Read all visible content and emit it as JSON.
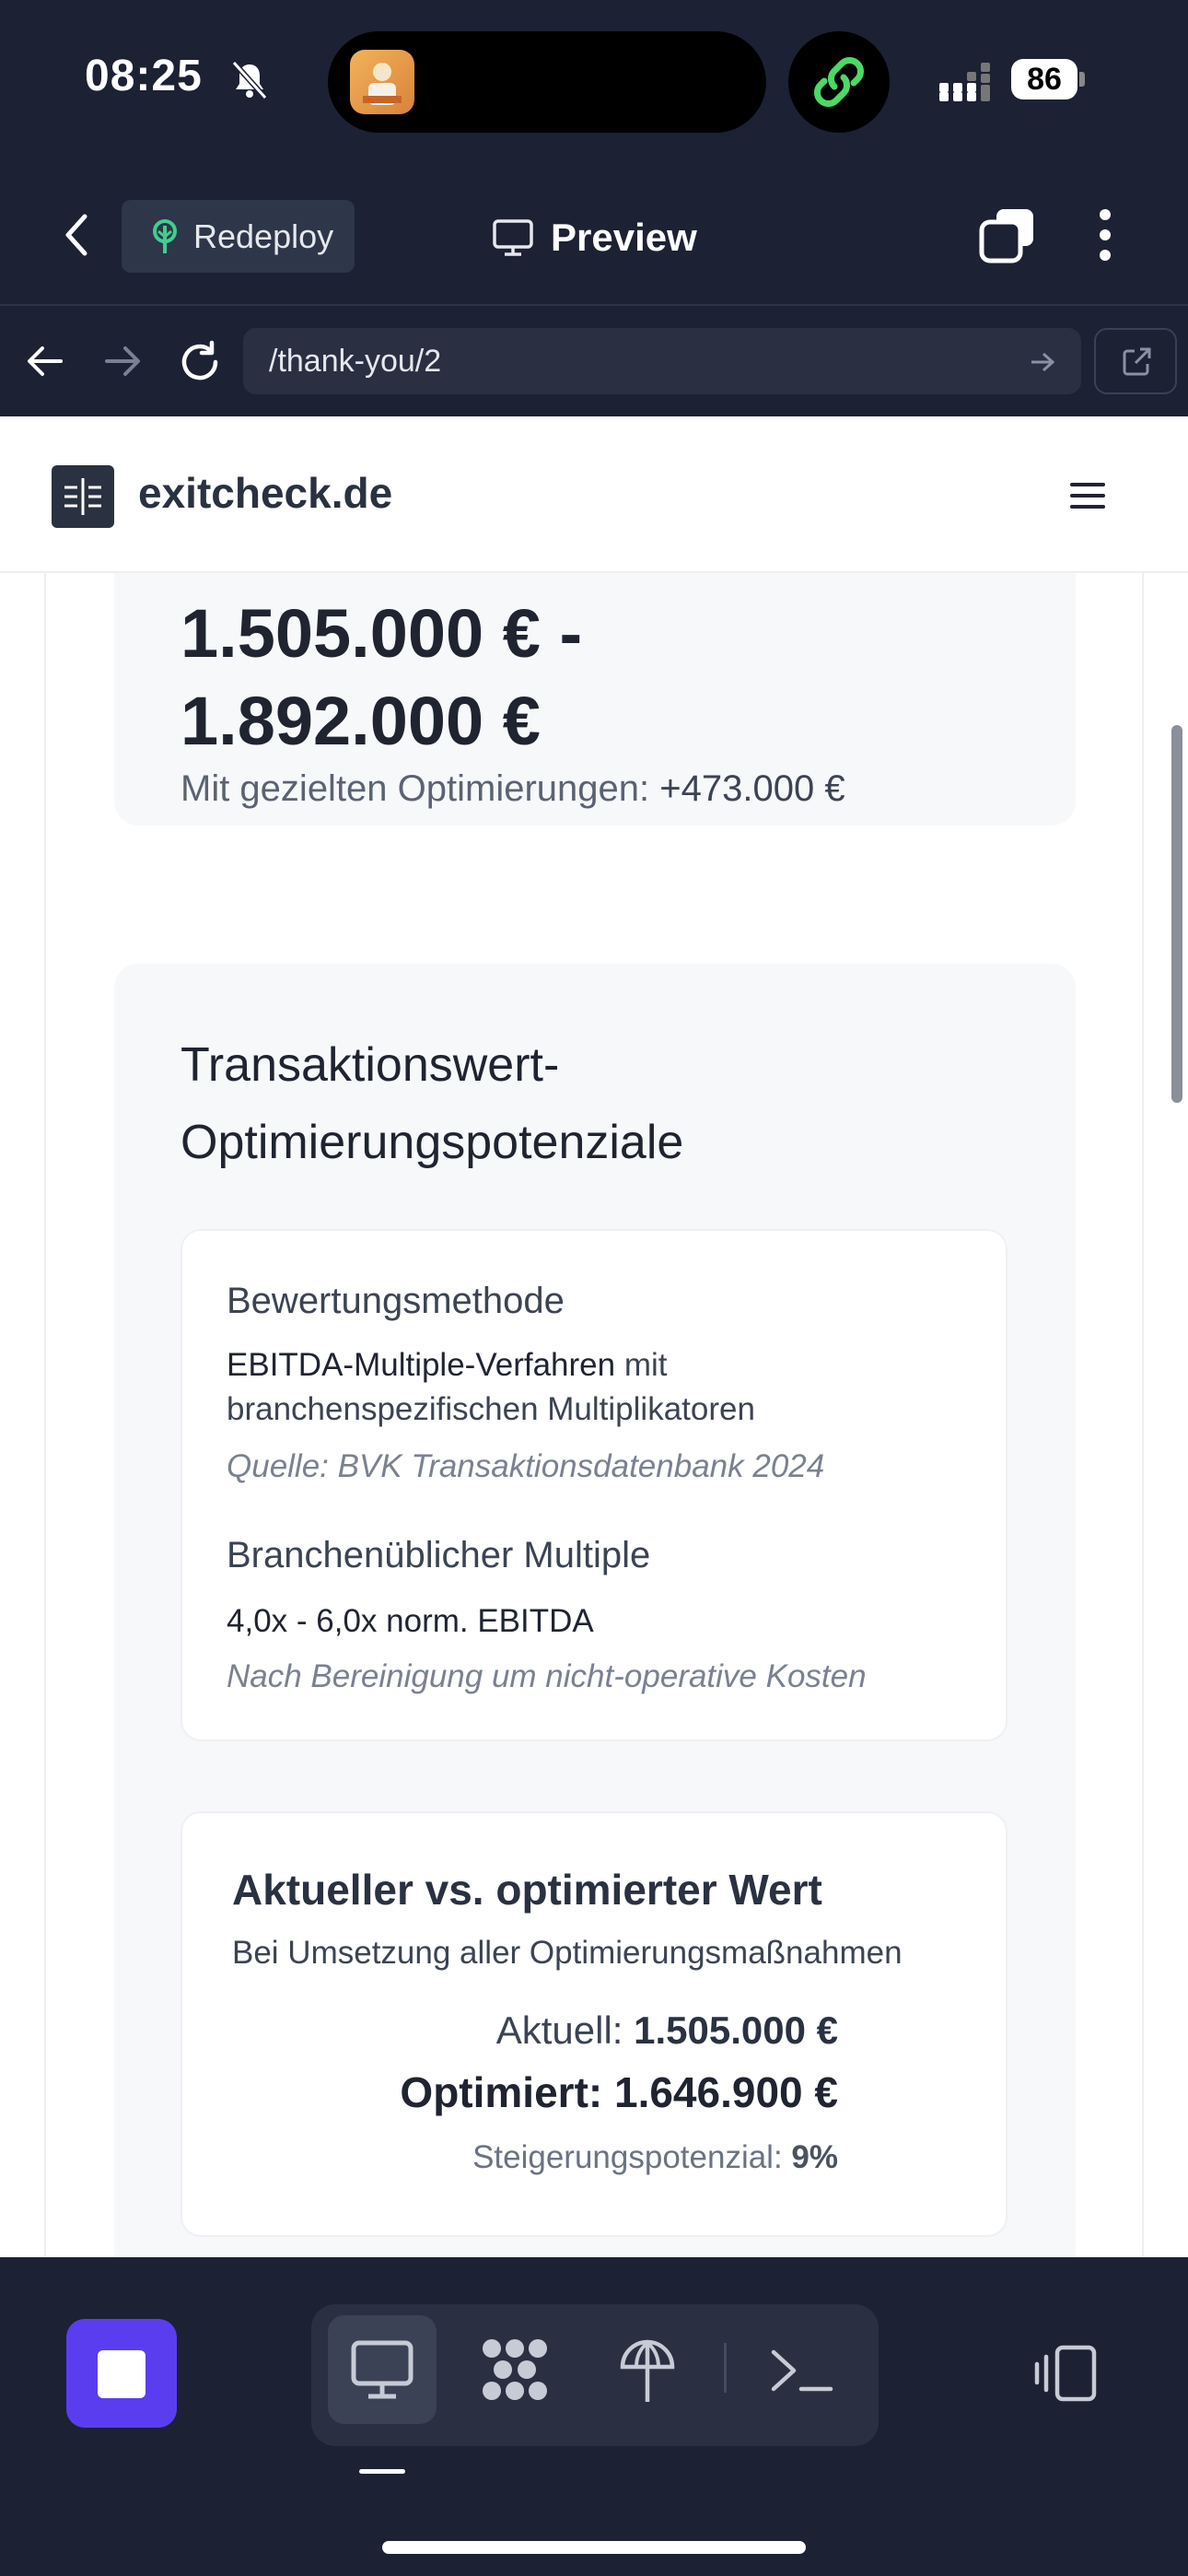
{
  "status_bar": {
    "time": "08:25",
    "battery": "86"
  },
  "app_bar": {
    "redeploy_label": "Redeploy",
    "preview_label": "Preview"
  },
  "browser": {
    "url": "/thank-you/2"
  },
  "site": {
    "name": "exitcheck.de"
  },
  "value_card": {
    "range_line1": "1.505.000 € -",
    "range_line2": "1.892.000 €",
    "optimization_prefix": "Mit gezielten Optimierungen: ",
    "optimization_value": "+473.000 €"
  },
  "potential_card": {
    "title_line1": "Transaktionswert-",
    "title_line2": "Optimierungspotenziale",
    "method": {
      "heading": "Bewertungsmethode",
      "strong": "EBITDA-Multiple-Verfahren",
      "rest_line1": " mit",
      "line2": "branchenspezifischen Multiplikatoren",
      "source": "Quelle: BVK Transaktionsdatenbank 2024"
    },
    "multiple": {
      "heading": "Branchenüblicher Multiple",
      "value": "4,0x - 6,0x norm. EBITDA",
      "note": "Nach Bereinigung um nicht-operative Kosten"
    }
  },
  "comparison_card": {
    "title": "Aktueller vs. optimierter Wert",
    "subtitle": "Bei Umsetzung aller Optimierungsmaßnahmen",
    "current_label": "Aktuell: ",
    "current_value": "1.505.000 €",
    "optimized_label": "Optimiert: ",
    "optimized_value": "1.646.900 €",
    "increase_label": "Steigerungspotenzial: ",
    "increase_value": "9%"
  },
  "icons": [
    "bell-slash-icon",
    "link-icon",
    "signal-icon",
    "back-chevron-icon",
    "tree-icon",
    "monitor-icon",
    "copy-icon",
    "more-vertical-icon",
    "arrow-left-icon",
    "arrow-right-icon",
    "reload-icon",
    "go-arrow-icon",
    "external-link-icon",
    "logo-icon",
    "hamburger-icon",
    "stop-icon",
    "desktop-icon",
    "apps-icon",
    "deploy-icon",
    "terminal-icon",
    "devices-icon"
  ],
  "colors": {
    "dark_bg": "#1c2133",
    "accent_purple": "#5b3df0",
    "card_bg": "#f7f8fa",
    "text_dark": "#1f2430"
  }
}
